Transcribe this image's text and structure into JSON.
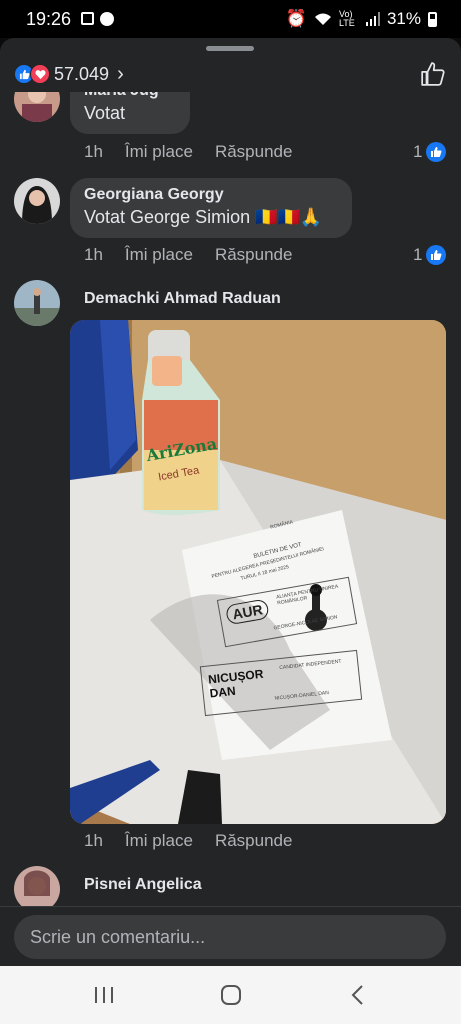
{
  "status_bar": {
    "time": "19:26",
    "battery": "31%",
    "network": "Vo) LTE"
  },
  "header": {
    "reaction_count": "57.049"
  },
  "comments": [
    {
      "author": "Maria Jug",
      "text": "Votat",
      "time": "1h",
      "like_label": "Îmi place",
      "reply_label": "Răspunde",
      "likes": "1"
    },
    {
      "author": "Georgiana Georgy",
      "text": "Votat George Simion 🇷🇴🇷🇴🙏",
      "time": "1h",
      "like_label": "Îmi place",
      "reply_label": "Răspunde",
      "likes": "1"
    },
    {
      "author": "Demachki Ahmad Raduan",
      "time": "1h",
      "like_label": "Îmi place",
      "reply_label": "Răspunde"
    },
    {
      "author": "Pisnei Angelica"
    }
  ],
  "photo": {
    "bottle_brand": "AriZona",
    "bottle_label": "Iced Tea",
    "ballot_header": "ROMÂNIA",
    "ballot_title": "BULETIN DE VOT",
    "ballot_subtitle": "PENTRU ALEGEREA PREȘEDINTELUI ROMÂNIEI",
    "ballot_round": "TURUL II   18 mai 2025",
    "option1_logo": "AUR",
    "option1_party": "ALIANȚA PENTRU UNIREA ROMÂNILOR",
    "option1_candidate": "GEORGE-NICOLAE SIMION",
    "option2_logo_line1": "NICUȘOR",
    "option2_logo_line2": "DAN",
    "option2_party": "CANDIDAT INDEPENDENT",
    "option2_candidate": "NICUȘOR-DANIEL DAN"
  },
  "composer": {
    "placeholder": "Scrie un comentariu..."
  }
}
